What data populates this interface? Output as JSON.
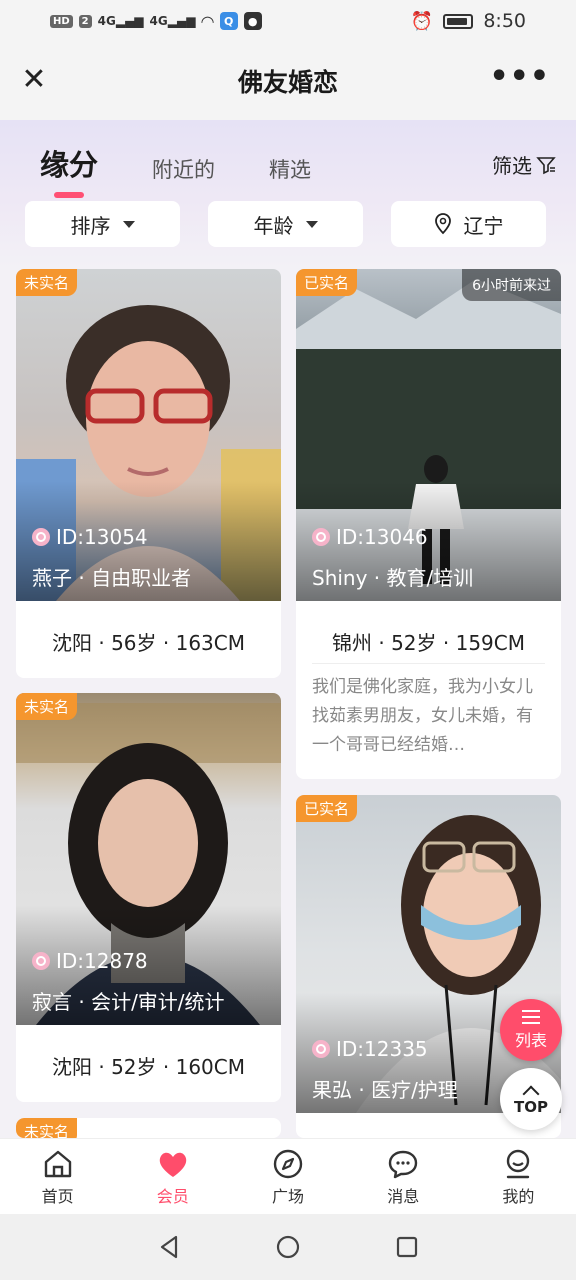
{
  "status_bar": {
    "left_icons": [
      "HD",
      "2",
      "4G",
      "4G"
    ],
    "time": "8:50"
  },
  "nav": {
    "title": "佛友婚恋"
  },
  "tabs": [
    {
      "label": "缘分",
      "active": true
    },
    {
      "label": "附近的",
      "active": false
    },
    {
      "label": "精选",
      "active": false
    }
  ],
  "filter_label": "筛选",
  "dropdowns": {
    "sort": "排序",
    "age": "年龄",
    "location": "辽宁"
  },
  "cards": [
    {
      "badge": "未实名",
      "id": "ID:13054",
      "name_job": "燕子 · 自由职业者",
      "info": "沈阳 · 56岁 · 163CM"
    },
    {
      "badge": "已实名",
      "recent": "6小时前来过",
      "id": "ID:13046",
      "name_job": "Shiny · 教育/培训",
      "info": "锦州 · 52岁 · 159CM",
      "desc": "我们是佛化家庭，我为小女儿找茹素男朋友，女儿未婚，有一个哥哥已经结婚…"
    },
    {
      "badge": "未实名",
      "id": "ID:12878",
      "name_job": "寂言 · 会计/审计/统计",
      "info": "沈阳 · 52岁 · 160CM"
    },
    {
      "badge": "已实名",
      "id": "ID:12335",
      "name_job": "果弘 · 医疗/护理"
    },
    {
      "badge": "未实名"
    }
  ],
  "fab": {
    "list_label": "列表",
    "top_label": "TOP"
  },
  "tabbar": [
    {
      "label": "首页",
      "icon": "home-icon",
      "active": false
    },
    {
      "label": "会员",
      "icon": "heart-icon",
      "active": true
    },
    {
      "label": "广场",
      "icon": "compass-icon",
      "active": false
    },
    {
      "label": "消息",
      "icon": "chat-icon",
      "active": false
    },
    {
      "label": "我的",
      "icon": "profile-icon",
      "active": false
    }
  ],
  "colors": {
    "accent": "#ff4d6b",
    "badge": "#f5962e",
    "underline": "#ff5074"
  }
}
